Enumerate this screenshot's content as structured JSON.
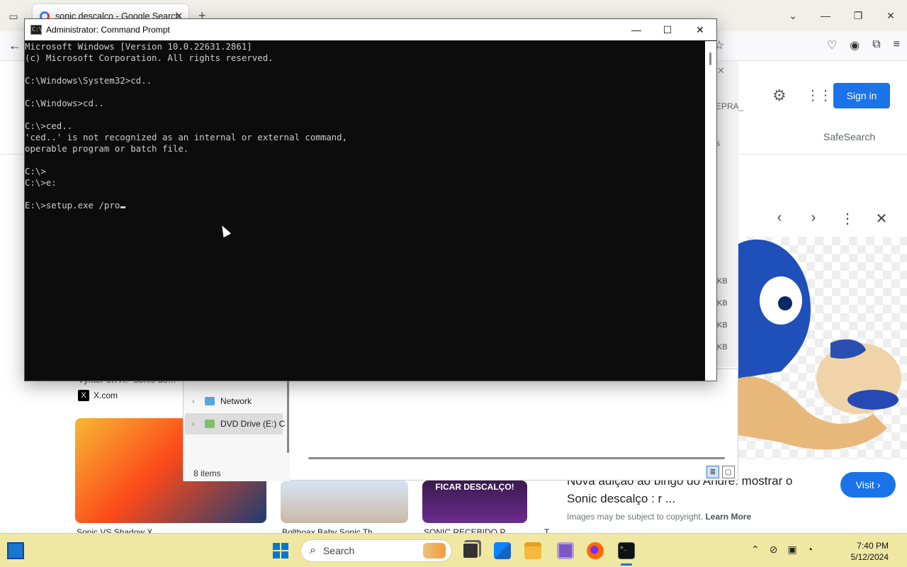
{
  "browser": {
    "tab_title": "sonic descalco - Google Search",
    "new_tab": "+",
    "tab_close": "✕",
    "back": "←",
    "window_controls": {
      "min": "—",
      "max": "❐",
      "close": "✕",
      "list": "⌄"
    }
  },
  "google": {
    "sign_in": "Sign in",
    "safesearch": "SafeSearch",
    "panel_prev": "‹",
    "panel_next": "›",
    "panel_more": "⋮",
    "panel_close": "✕",
    "preview_title": "Nova adição ao bingo do André: mostrar o Sonic descalço : r ...",
    "visit": "Visit ›",
    "copyright": "Images may be subject to copyright.",
    "learn_more": "Learn More",
    "source_left": "Vyktor on X: \"sonic de...",
    "xcom": "X.com",
    "thumb3_label": "FICAR DESCALÇO!",
    "captions": [
      "Sonic VS Shadow X...",
      "Bolthoax Baby Sonic Th...",
      "SONIC RECEBIDO P...",
      "T"
    ],
    "ghost_text": "EPRA_",
    "ghost_s": "s",
    "kb_labels": [
      "KB",
      "KB",
      "KB",
      "KB"
    ]
  },
  "explorer": {
    "nav_items": [
      {
        "label": "Network",
        "icon": "network-icon"
      },
      {
        "label": "DVD Drive (E:) C",
        "icon": "dvd-drive-icon"
      }
    ],
    "status": "8 items"
  },
  "cmd": {
    "title": "Administrator: Command Prompt",
    "lines": [
      "Microsoft Windows [Version 10.0.22631.2861]",
      "(c) Microsoft Corporation. All rights reserved.",
      "",
      "C:\\Windows\\System32>cd..",
      "",
      "C:\\Windows>cd..",
      "",
      "C:\\>ced..",
      "'ced..' is not recognized as an internal or external command,",
      "operable program or batch file.",
      "",
      "C:\\>",
      "C:\\>e:",
      "",
      "E:\\>setup.exe /pro"
    ]
  },
  "taskbar": {
    "search_placeholder": "Search",
    "time": "7:40 PM",
    "date": "5/12/2024",
    "tray_chevron": "⌃"
  }
}
